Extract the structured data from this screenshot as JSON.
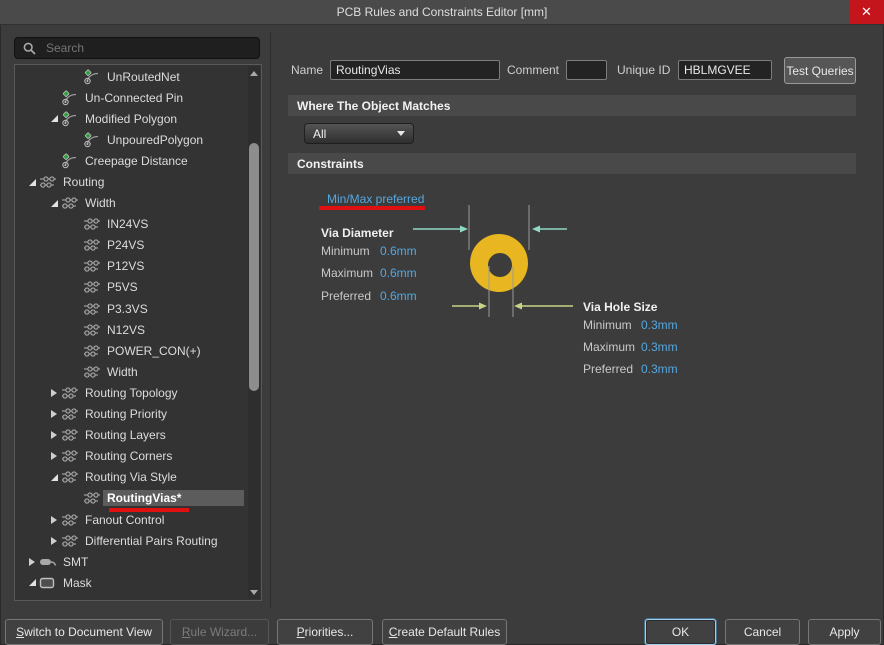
{
  "window": {
    "title": "PCB Rules and Constraints Editor [mm]",
    "close_glyph": "✕"
  },
  "sidebar": {
    "search_placeholder": "Search",
    "tree": [
      {
        "label": "UnRoutedNet",
        "level": 3,
        "icon": "rule"
      },
      {
        "label": "Un-Connected Pin",
        "level": 2,
        "icon": "rule"
      },
      {
        "label": "Modified Polygon",
        "level": 2,
        "icon": "rule",
        "arrow": "expanded"
      },
      {
        "label": "UnpouredPolygon",
        "level": 3,
        "icon": "rule"
      },
      {
        "label": "Creepage Distance",
        "level": 2,
        "icon": "rule"
      },
      {
        "label": "Routing",
        "level": 1,
        "icon": "net",
        "arrow": "expanded"
      },
      {
        "label": "Width",
        "level": 2,
        "icon": "net",
        "arrow": "expanded"
      },
      {
        "label": "IN24VS",
        "level": 3,
        "icon": "net"
      },
      {
        "label": "P24VS",
        "level": 3,
        "icon": "net"
      },
      {
        "label": "P12VS",
        "level": 3,
        "icon": "net"
      },
      {
        "label": "P5VS",
        "level": 3,
        "icon": "net"
      },
      {
        "label": "P3.3VS",
        "level": 3,
        "icon": "net"
      },
      {
        "label": "N12VS",
        "level": 3,
        "icon": "net"
      },
      {
        "label": "POWER_CON(+)",
        "level": 3,
        "icon": "net"
      },
      {
        "label": "Width",
        "level": 3,
        "icon": "net"
      },
      {
        "label": "Routing Topology",
        "level": 2,
        "icon": "net",
        "arrow": "collapsed"
      },
      {
        "label": "Routing Priority",
        "level": 2,
        "icon": "net",
        "arrow": "collapsed"
      },
      {
        "label": "Routing Layers",
        "level": 2,
        "icon": "net",
        "arrow": "collapsed"
      },
      {
        "label": "Routing Corners",
        "level": 2,
        "icon": "net",
        "arrow": "collapsed"
      },
      {
        "label": "Routing Via Style",
        "level": 2,
        "icon": "net",
        "arrow": "expanded"
      },
      {
        "label": "RoutingVias*",
        "level": 3,
        "icon": "net",
        "selected": true,
        "underlined": true
      },
      {
        "label": "Fanout Control",
        "level": 2,
        "icon": "net",
        "arrow": "collapsed"
      },
      {
        "label": "Differential Pairs Routing",
        "level": 2,
        "icon": "net",
        "arrow": "collapsed"
      },
      {
        "label": "SMT",
        "level": 1,
        "icon": "smt",
        "arrow": "collapsed"
      },
      {
        "label": "Mask",
        "level": 1,
        "icon": "mask",
        "arrow": "expanded"
      }
    ]
  },
  "form": {
    "name_label": "Name",
    "name_value": "RoutingVias",
    "comment_label": "Comment",
    "comment_value": "",
    "unique_id_label": "Unique ID",
    "unique_id_value": "HBLMGVEE",
    "test_queries_label": "Test Queries"
  },
  "match_section": {
    "header": "Where The Object Matches",
    "scope_value": "All"
  },
  "constraints_section": {
    "header": "Constraints",
    "mode_link": "Min/Max preferred",
    "via_diameter": {
      "title": "Via Diameter",
      "minimum_label": "Minimum",
      "minimum_value": "0.6mm",
      "maximum_label": "Maximum",
      "maximum_value": "0.6mm",
      "preferred_label": "Preferred",
      "preferred_value": "0.6mm"
    },
    "via_hole_size": {
      "title": "Via Hole Size",
      "minimum_label": "Minimum",
      "minimum_value": "0.3mm",
      "maximum_label": "Maximum",
      "maximum_value": "0.3mm",
      "preferred_label": "Preferred",
      "preferred_value": "0.3mm"
    }
  },
  "footer": {
    "buttons": [
      {
        "label": "Switch to Document View"
      },
      {
        "label": "Rule Wizard..."
      },
      {
        "label": "Priorities..."
      },
      {
        "label": "Create Default Rules"
      },
      {
        "label": "OK"
      },
      {
        "label": "Cancel"
      },
      {
        "label": "Apply"
      }
    ]
  },
  "colors": {
    "value_text_blue": "#55a7e0",
    "annotation_red": "#e01010",
    "via_pad_yellow": "#e7b620",
    "diameter_arrow_teal": "#8fd8c4",
    "hole_arrow_olive": "#c5d487",
    "close_button_red": "#c4151c",
    "titlebar_gray": "#4a4a4a"
  }
}
